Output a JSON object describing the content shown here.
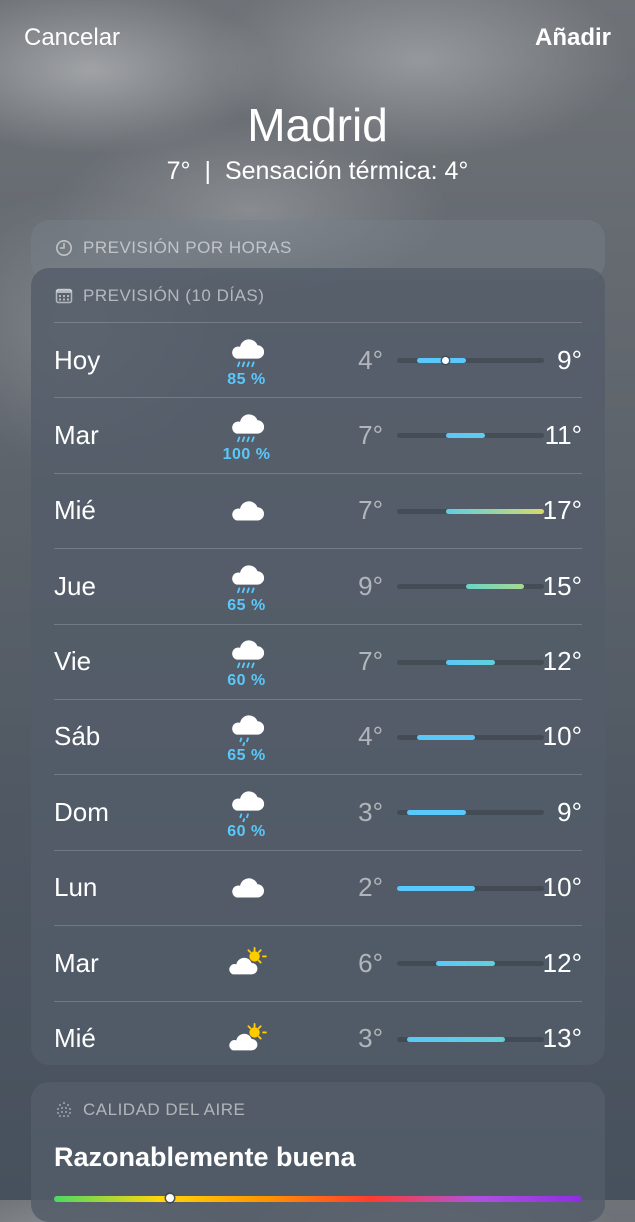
{
  "topbar": {
    "cancel_label": "Cancelar",
    "add_label": "Añadir"
  },
  "location": {
    "city": "Madrid",
    "current_temp": "7°",
    "separator": "|",
    "feels_like": "Sensación térmica: 4°"
  },
  "hourly_card": {
    "title": "PREVISIÓN POR HORAS"
  },
  "daily_card": {
    "title": "PREVISIÓN (10 DÍAS)",
    "range_min": 2,
    "range_max": 17,
    "days": [
      {
        "day": "Hoy",
        "icon": "cloud-rain-icon",
        "precip": "85 %",
        "low": "4°",
        "high": "9°",
        "low_val": 4,
        "high_val": 9,
        "current_val": 7,
        "bar_colors": [
          "#5ac8fa",
          "#5ac8fa"
        ]
      },
      {
        "day": "Mar",
        "icon": "cloud-rain-icon",
        "precip": "100 %",
        "low": "7°",
        "high": "11°",
        "low_val": 7,
        "high_val": 11,
        "bar_colors": [
          "#5ac8fa",
          "#62cbe8"
        ]
      },
      {
        "day": "Mié",
        "icon": "cloud-icon",
        "precip": "",
        "low": "7°",
        "high": "17°",
        "low_val": 7,
        "high_val": 17,
        "bar_colors": [
          "#5ad1e0",
          "#d6d86a"
        ]
      },
      {
        "day": "Jue",
        "icon": "cloud-rain-icon",
        "precip": "65 %",
        "low": "9°",
        "high": "15°",
        "low_val": 9,
        "high_val": 15,
        "bar_colors": [
          "#6ad4c8",
          "#a8d890"
        ]
      },
      {
        "day": "Vie",
        "icon": "cloud-rain-icon",
        "precip": "60 %",
        "low": "7°",
        "high": "12°",
        "low_val": 7,
        "high_val": 12,
        "bar_colors": [
          "#5ac8fa",
          "#62d0d8"
        ]
      },
      {
        "day": "Sáb",
        "icon": "cloud-drizzle-icon",
        "precip": "65 %",
        "low": "4°",
        "high": "10°",
        "low_val": 4,
        "high_val": 10,
        "bar_colors": [
          "#5ac8fa",
          "#5ac8fa"
        ]
      },
      {
        "day": "Dom",
        "icon": "cloud-drizzle-icon",
        "precip": "60 %",
        "low": "3°",
        "high": "9°",
        "low_val": 3,
        "high_val": 9,
        "bar_colors": [
          "#5ac8fa",
          "#5ac8fa"
        ]
      },
      {
        "day": "Lun",
        "icon": "cloud-icon",
        "precip": "",
        "low": "2°",
        "high": "10°",
        "low_val": 2,
        "high_val": 10,
        "bar_colors": [
          "#5ac8fa",
          "#5ac8fa"
        ]
      },
      {
        "day": "Mar",
        "icon": "partly-sunny-icon",
        "precip": "",
        "low": "6°",
        "high": "12°",
        "low_val": 6,
        "high_val": 12,
        "bar_colors": [
          "#5ac8fa",
          "#62d0d8"
        ]
      },
      {
        "day": "Mié",
        "icon": "partly-sunny-icon",
        "precip": "",
        "low": "3°",
        "high": "13°",
        "low_val": 3,
        "high_val": 13,
        "bar_colors": [
          "#5ac8fa",
          "#62d0d8"
        ]
      }
    ]
  },
  "air_quality": {
    "title": "CALIDAD DEL AIRE",
    "value": "Razonablemente buena"
  },
  "colors": {
    "precip": "#5ac8fa",
    "accent_cool": "#5ac8fa",
    "accent_warm": "#d6d86a"
  }
}
